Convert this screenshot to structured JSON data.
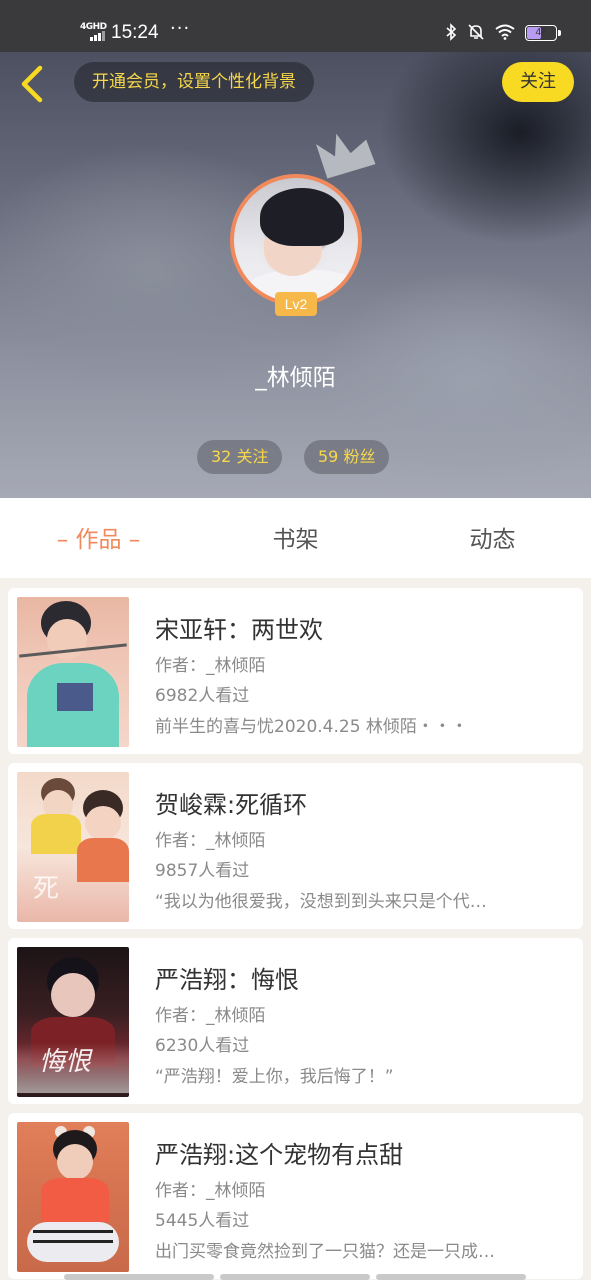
{
  "status_bar": {
    "network": "4GHD",
    "time": "15:24",
    "dots": "···",
    "battery": "47"
  },
  "header": {
    "vip_banner": "开通会员，设置个性化背景",
    "follow_label": "关注",
    "level": "Lv2",
    "username": "_林倾陌",
    "following": "32 关注",
    "fans": "59 粉丝"
  },
  "tabs": [
    {
      "label": "– 作品 –",
      "active": true
    },
    {
      "label": "书架",
      "active": false
    },
    {
      "label": "动态",
      "active": false
    }
  ],
  "works": [
    {
      "title": "宋亚轩：两世欢",
      "author": "作者：_林倾陌",
      "views": "6982人看过",
      "summary": "前半生的喜与忧2020.4.25 林倾陌・・・"
    },
    {
      "title": "贺峻霖:死循环",
      "author": "作者：_林倾陌",
      "views": "9857人看过",
      "summary": "“我以为他很爱我，没想到到头来只是个代…"
    },
    {
      "title": "严浩翔：悔恨",
      "author": "作者：_林倾陌",
      "views": "6230人看过",
      "summary": "“严浩翔！爱上你，我后悔了！”"
    },
    {
      "title": "严浩翔:这个宠物有点甜",
      "author": "作者：_林倾陌",
      "views": "5445人看过",
      "summary": "出门买零食竟然捡到了一只猫？还是一只成…"
    }
  ],
  "colors": {
    "accent_orange": "#f08a5d",
    "follow_yellow": "#f9da22",
    "vip_text": "#f7d84a"
  }
}
